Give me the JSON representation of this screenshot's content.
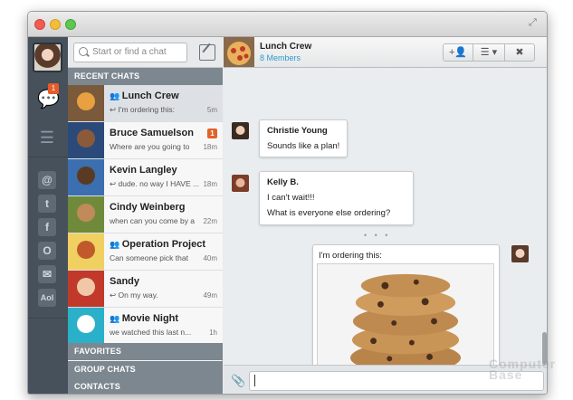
{
  "search": {
    "placeholder": "Start or find a chat"
  },
  "rail": {
    "chat_badge": "1",
    "services": [
      "@",
      "t",
      "f",
      "O",
      "✉",
      "Aol"
    ]
  },
  "sections": {
    "recent": "RECENT CHATS",
    "favorites": "FAVORITES",
    "group_chats": "GROUP CHATS",
    "contacts": "CONTACTS"
  },
  "chats": [
    {
      "name": "Lunch Crew",
      "preview": "I'm ordering this:",
      "time": "5m",
      "group": true,
      "active": true,
      "unread": "",
      "reply": true
    },
    {
      "name": "Bruce Samuelson",
      "preview": "Where are you going to",
      "time": "18m",
      "group": false,
      "active": false,
      "unread": "1",
      "reply": false
    },
    {
      "name": "Kevin Langley",
      "preview": "dude. no way I HAVE ...",
      "time": "18m",
      "group": false,
      "active": false,
      "unread": "",
      "reply": true
    },
    {
      "name": "Cindy Weinberg",
      "preview": "when can you come by a",
      "time": "22m",
      "group": false,
      "active": false,
      "unread": "",
      "reply": false
    },
    {
      "name": "Operation Project",
      "preview": "Can someone pick that",
      "time": "40m",
      "group": true,
      "active": false,
      "unread": "",
      "reply": false
    },
    {
      "name": "Sandy",
      "preview": "On my way.",
      "time": "49m",
      "group": false,
      "active": false,
      "unread": "",
      "reply": true
    },
    {
      "name": "Movie Night",
      "preview": "we watched this last n...",
      "time": "1h",
      "group": true,
      "active": false,
      "unread": "",
      "reply": false
    }
  ],
  "conversation": {
    "title": "Lunch Crew",
    "members": "8 Members",
    "buttons": [
      "+👤",
      "☰ ▾",
      "✖"
    ],
    "messages": [
      {
        "author": "Christie Young",
        "lines": [
          "Sounds like a plan!"
        ]
      },
      {
        "author": "Kelly B.",
        "lines": [
          "I can't wait!!!",
          "What is everyone else ordering?"
        ]
      },
      {
        "author": "",
        "lines": [
          "I'm ordering this:"
        ]
      }
    ],
    "typing_dots": "• • •",
    "input_value": ""
  },
  "watermark": "Computer Base",
  "colors": {
    "accent": "#2e9bd0",
    "badge": "#e2612a",
    "rail": "#46515b",
    "section": "#7d878f"
  }
}
